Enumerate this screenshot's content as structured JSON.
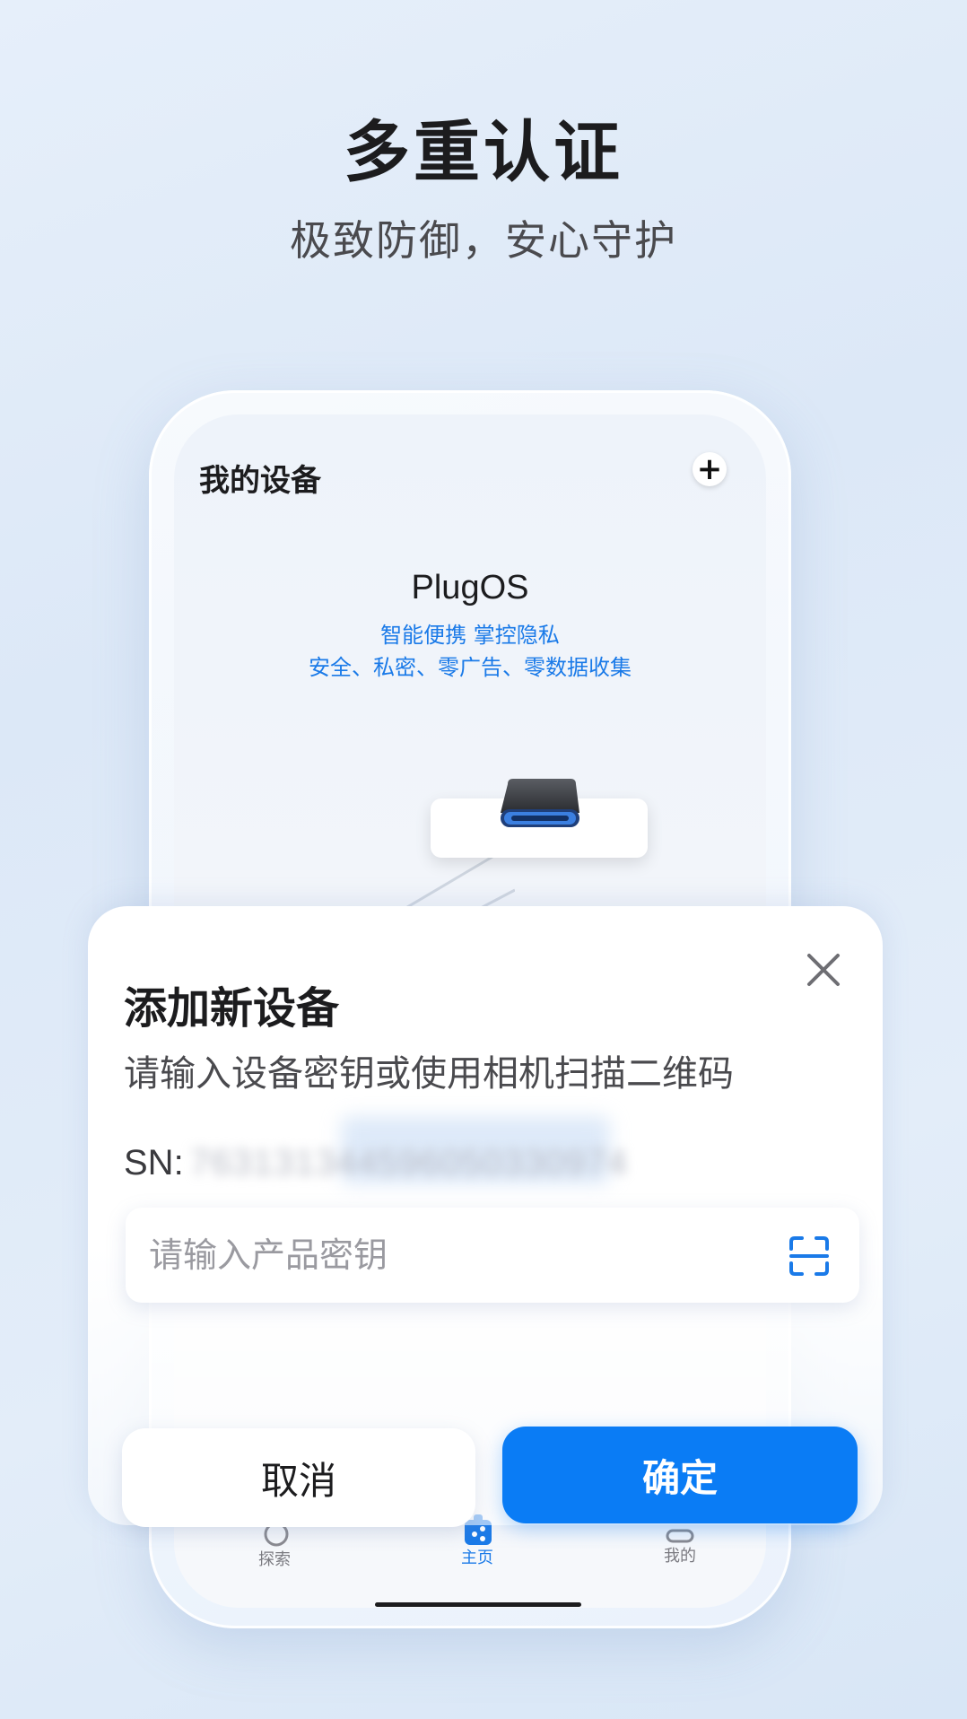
{
  "promo": {
    "title": "多重认证",
    "subtitle": "极致防御，安心守护"
  },
  "phone_screen": {
    "title": "我的设备",
    "add_icon": "plus-icon",
    "brand_name": "PlugOS",
    "tagline_1": "智能便携  掌控隐私",
    "tagline_2": "安全、私密、零广告、零数据收集"
  },
  "tabbar": {
    "items": [
      {
        "label": "探索",
        "icon": "explore-icon"
      },
      {
        "label": "主页",
        "icon": "home-icon"
      },
      {
        "label": "我的",
        "icon": "profile-icon"
      }
    ],
    "active_index": 1
  },
  "dialog": {
    "title": "添加新设备",
    "description": "请输入设备密钥或使用相机扫描二维码",
    "sn_label": "SN:",
    "sn_value": "7631313445960503309​74",
    "key_placeholder": "请输入产品密钥",
    "key_value": "",
    "cancel_label": "取消",
    "confirm_label": "确定"
  },
  "colors": {
    "accent": "#0a7cf5",
    "tagline": "#1a7ae8"
  }
}
